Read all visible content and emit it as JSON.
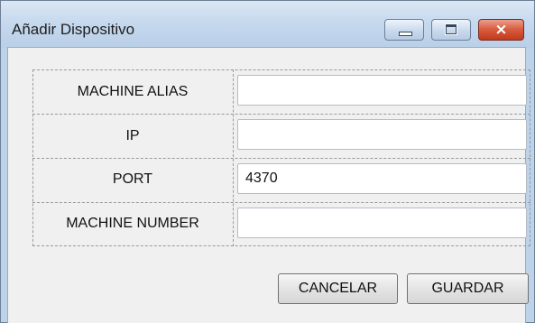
{
  "window": {
    "title": "Añadir Dispositivo",
    "controls": {
      "minimize": "minimize",
      "maximize": "maximize",
      "close": "×"
    }
  },
  "form": {
    "fields": [
      {
        "label": "MACHINE ALIAS",
        "value": "",
        "placeholder": ""
      },
      {
        "label": "IP",
        "value": "",
        "placeholder": ""
      },
      {
        "label": "PORT",
        "value": "4370",
        "placeholder": ""
      },
      {
        "label": "MACHINE NUMBER",
        "value": "",
        "placeholder": ""
      }
    ]
  },
  "buttons": {
    "cancel": "CANCELAR",
    "save": "GUARDAR"
  },
  "colors": {
    "title_bar": "#c6d9ee",
    "client": "#f0f0f0",
    "close_button": "#d65a3c"
  }
}
